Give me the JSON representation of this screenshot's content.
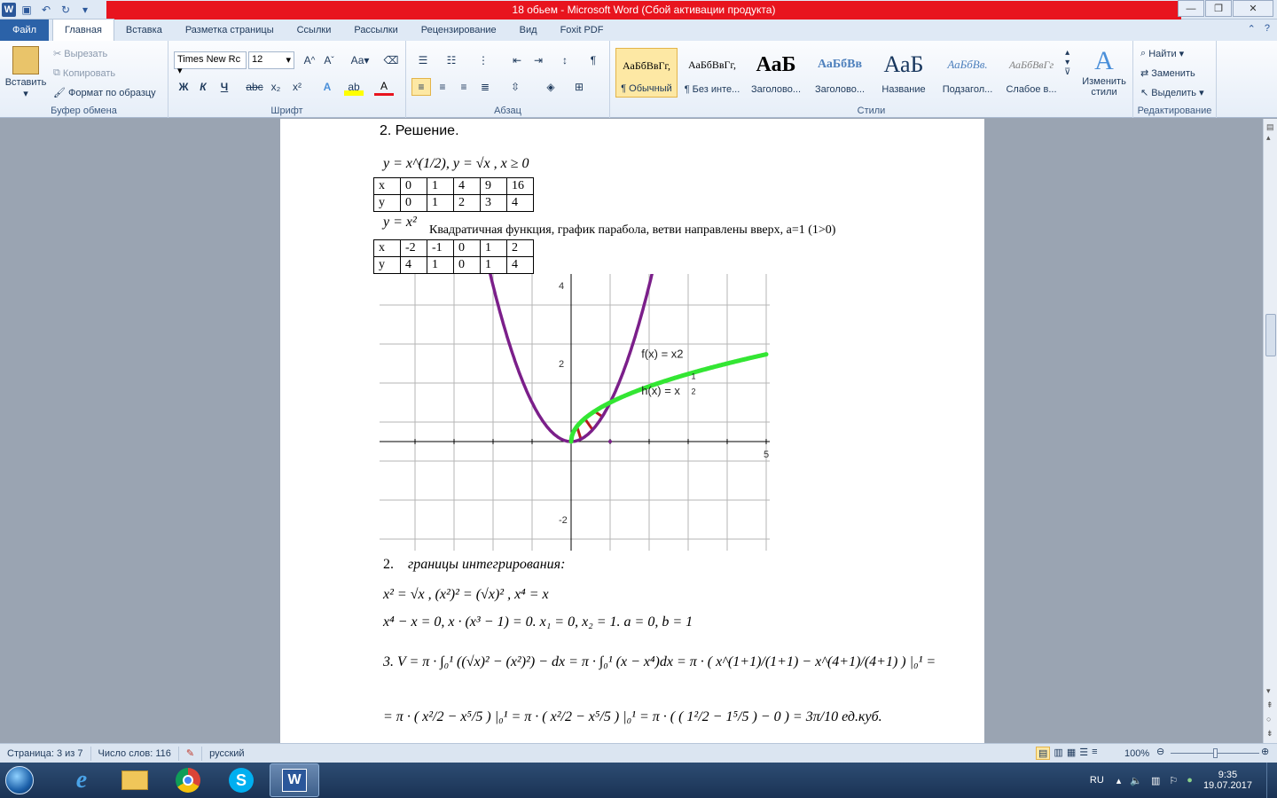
{
  "window": {
    "title": "18 обьем  -  Microsoft Word (Сбой активации продукта)"
  },
  "tabs": [
    "Файл",
    "Главная",
    "Вставка",
    "Разметка страницы",
    "Ссылки",
    "Рассылки",
    "Рецензирование",
    "Вид",
    "Foxit PDF"
  ],
  "clipboard": {
    "paste": "Вставить",
    "cut": "Вырезать",
    "copy": "Копировать",
    "format_painter": "Формат по образцу",
    "label": "Буфер обмена"
  },
  "font": {
    "family": "Times New Rc",
    "size": "12",
    "label": "Шрифт",
    "bold": "Ж",
    "italic": "К",
    "underline": "Ч",
    "strike": "abc",
    "aa": "Аа"
  },
  "paragraph": {
    "label": "Абзац"
  },
  "styles": {
    "label": "Стили",
    "items": [
      {
        "preview": "АаБбВвГг,",
        "name": "¶ Обычный"
      },
      {
        "preview": "АаБбВвГг,",
        "name": "¶ Без инте..."
      },
      {
        "preview": "АаБ",
        "name": "Заголово..."
      },
      {
        "preview": "АаБбВв",
        "name": "Заголово..."
      },
      {
        "preview": "АаБ",
        "name": "Название"
      },
      {
        "preview": "АаБбВв.",
        "name": "Подзагол..."
      },
      {
        "preview": "АаБбВвГг",
        "name": "Слабое в..."
      }
    ],
    "change": "Изменить стили"
  },
  "editing": {
    "find": "Найти",
    "replace": "Заменить",
    "select": "Выделить",
    "label": "Редактирование"
  },
  "doc": {
    "heading": "2. Решение.",
    "eq1": "y = x^(1/2),    y = √x , x ≥ 0",
    "table1": {
      "rows": [
        [
          "x",
          "0",
          "1",
          "4",
          "9",
          "16"
        ],
        [
          "y",
          "0",
          "1",
          "2",
          "3",
          "4"
        ]
      ]
    },
    "eq2": "y = x²",
    "desc": "Квадратичная функция, график парабола, ветви направлены вверх, а=1 (1>0)",
    "table2": {
      "rows": [
        [
          "x",
          "-2",
          "-1",
          "0",
          "1",
          "2"
        ],
        [
          "y",
          "4",
          "1",
          "0",
          "1",
          "4"
        ]
      ]
    },
    "step2_num": "2.",
    "step2_text": "границы интегрирования:",
    "line_a": "x² = √x ,    (x²)² = (√x)² ,    x⁴ = x",
    "line_b": "x⁴ − x = 0,    x · (x³ − 1) = 0.    x₁ = 0,    x₂ = 1.    a = 0, b = 1",
    "line_c": "3.   V = π · ∫₀¹ ((√x)² − (x²)²) − dx = π · ∫₀¹ (x − x⁴)dx = π · ( x^(1+1)/(1+1) − x^(4+1)/(4+1) ) |₀¹ =",
    "line_d": "= π · ( x²/2 − x⁵/5 ) |₀¹ = π · ( x²/2 − x⁵/5 ) |₀¹ = π · ( ( 1²/2 − 1⁵/5 ) − 0 ) = 3π/10 ед.куб."
  },
  "chart_data": {
    "type": "line",
    "xlim": [
      -4.5,
      5
    ],
    "ylim": [
      -2.8,
      4.3
    ],
    "yticks": [
      "4",
      "2",
      "-2"
    ],
    "xticks": [
      "5"
    ],
    "series": [
      {
        "name": "f(x) = x2",
        "function": "x^2",
        "color": "#7b1f8a"
      },
      {
        "name": "h(x) = x 1/2",
        "function": "x^(1/2)",
        "color": "#33e633"
      }
    ],
    "label_f": "f(x) = x2",
    "label_h": "h(x) = x",
    "label_h_exp_num": "1",
    "label_h_exp_den": "2",
    "grid": true
  },
  "status": {
    "page": "Страница: 3 из 7",
    "words": "Число слов: 116",
    "lang": "русский",
    "zoom": "100%"
  },
  "tray": {
    "lang": "RU",
    "time": "9:35",
    "date": "19.07.2017"
  }
}
